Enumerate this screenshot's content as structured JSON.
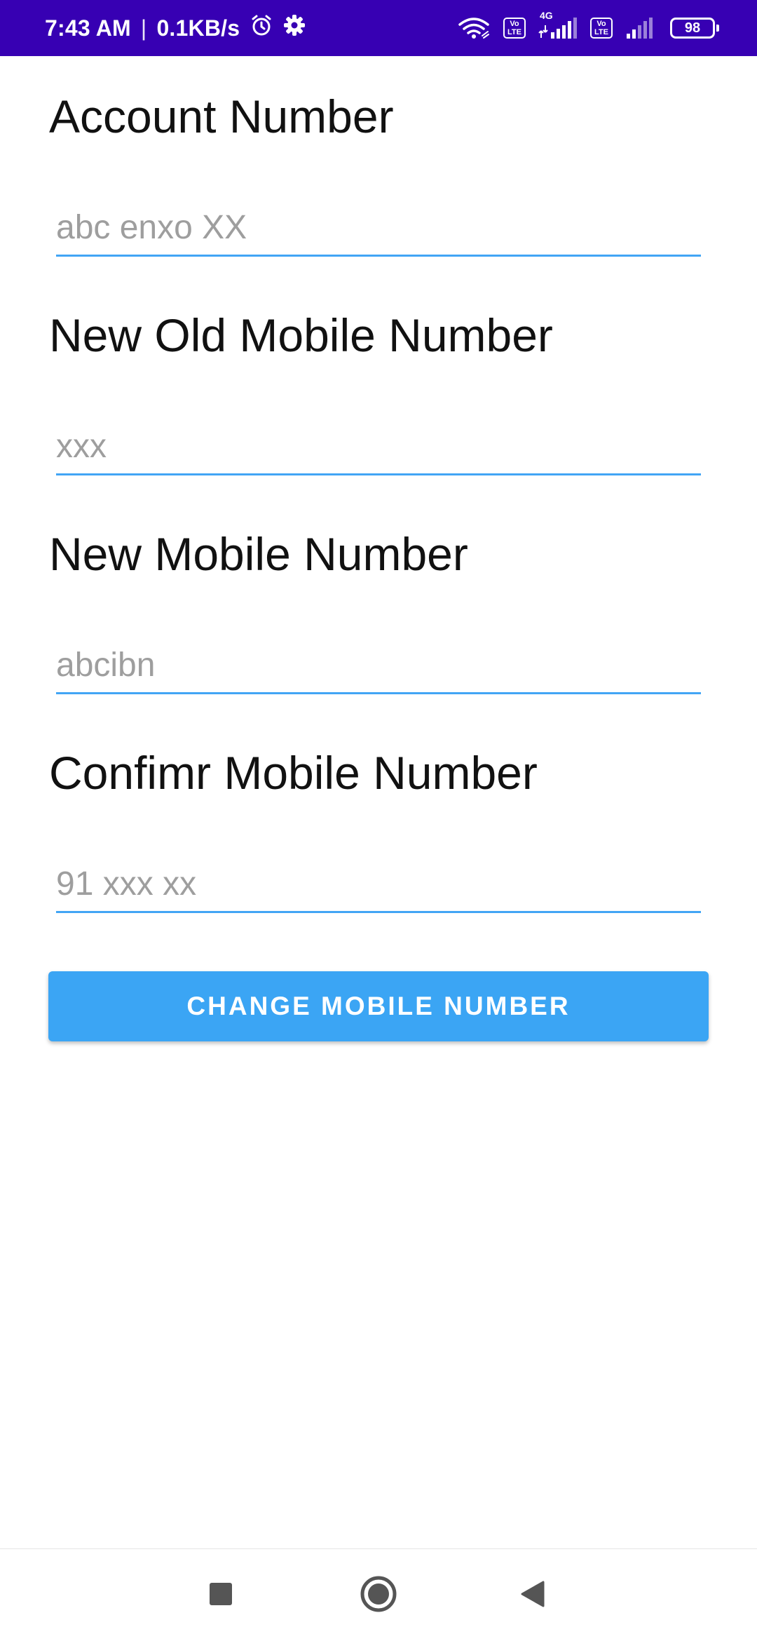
{
  "status_bar": {
    "time": "7:43 AM",
    "separator": "|",
    "net_speed": "0.1KB/s",
    "network_type": "4G",
    "volte_label": "Vo LTE",
    "battery_level": "98",
    "background_color": "#3700b3",
    "icons": [
      "alarm-icon",
      "gear-icon",
      "wifi-icon",
      "volte-icon",
      "signal-icon",
      "battery-icon"
    ]
  },
  "form": {
    "account_number": {
      "label": "Account Number",
      "placeholder": "abc enxo XX",
      "value": ""
    },
    "old_mobile": {
      "label": "New Old Mobile Number",
      "placeholder": "xxx",
      "value": ""
    },
    "new_mobile": {
      "label": "New Mobile Number",
      "placeholder": "abcibn",
      "value": ""
    },
    "confirm_mobile": {
      "label": "Confimr Mobile Number",
      "placeholder": "91 xxx xx",
      "value": ""
    },
    "submit_label": "CHANGE MOBILE NUMBER",
    "accent_color": "#42a5f5",
    "button_color": "#3ba5f4"
  },
  "nav_bar": {
    "icons": [
      "recents-square-icon",
      "home-circle-icon",
      "back-triangle-icon"
    ]
  }
}
